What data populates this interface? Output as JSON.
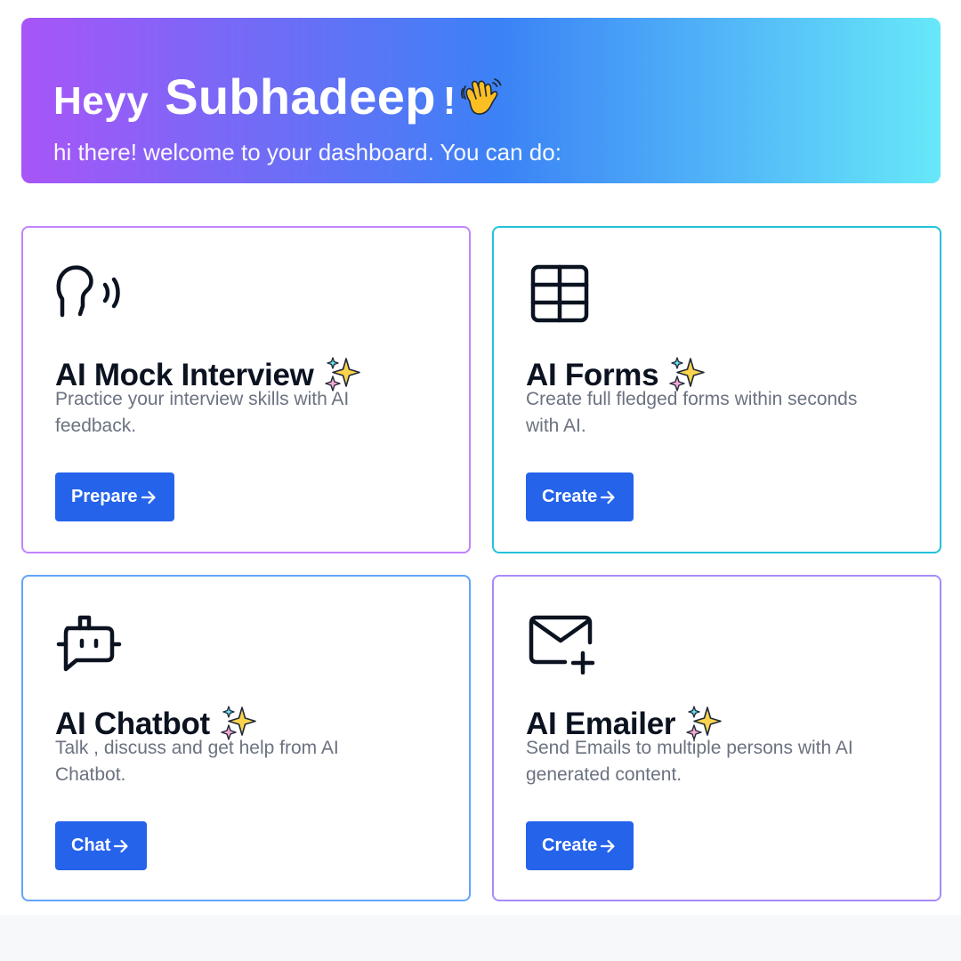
{
  "hero": {
    "greeting": "Heyy",
    "name": "Subhadeep",
    "exclamation": "!",
    "wave_icon": "waving-hand-emoji",
    "subtitle": "hi there! welcome to your dashboard. You can do:",
    "gradient_colors": [
      "#a855f7",
      "#3b82f6",
      "#67e8f9"
    ]
  },
  "cards": [
    {
      "icon": "speaking-head-icon",
      "title": "AI Mock Interview",
      "description": "Practice your interview skills with AI feedback.",
      "button_label": "Prepare",
      "border_color": "#c084fc"
    },
    {
      "icon": "table-grid-icon",
      "title": "AI Forms",
      "description": "Create full fledged forms within seconds with AI.",
      "button_label": "Create",
      "border_color": "#22c3d9"
    },
    {
      "icon": "robot-chat-icon",
      "title": "AI Chatbot",
      "description": "Talk , discuss and get help from AI Chatbot.",
      "button_label": "Chat",
      "border_color": "#60a5fa"
    },
    {
      "icon": "mail-plus-icon",
      "title": "AI Emailer",
      "description": "Send Emails to multiple persons with AI generated content.",
      "button_label": "Create",
      "border_color": "#a78bfa"
    }
  ],
  "colors": {
    "button_bg": "#2563eb",
    "text_dark": "#0b1220",
    "text_muted": "#6b7280"
  }
}
